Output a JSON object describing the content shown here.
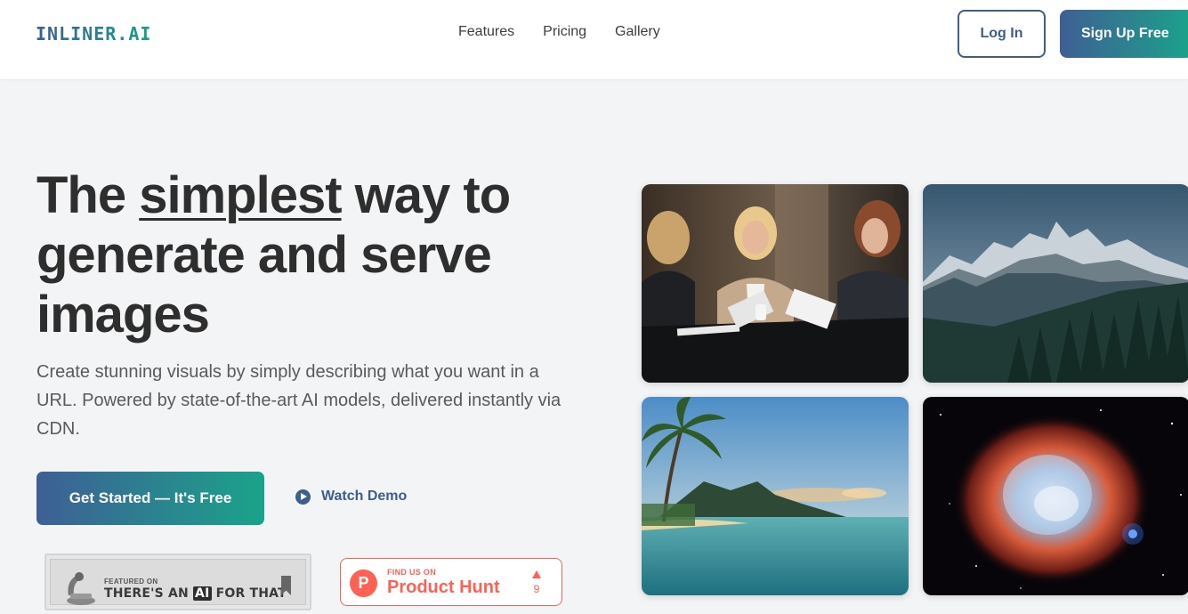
{
  "nav": {
    "logo": "INLINER.AI",
    "links": [
      "Features",
      "Pricing",
      "Gallery"
    ],
    "login_label": "Log In",
    "signup_label": "Sign Up Free"
  },
  "hero": {
    "title_part1": "The ",
    "title_emphasis": "simplest",
    "title_part2": " way to generate and serve images",
    "subtitle": "Create stunning visuals by simply describing what you want in a URL. Powered by state-of-the-art AI models, delivered instantly via CDN.",
    "cta_label": "Get Started — It's Free",
    "demo_label": "Watch Demo"
  },
  "badges": {
    "aift_small": "FEATURED ON",
    "aift_big_pre": "THERE'S AN ",
    "aift_big_ai": "AI",
    "aift_big_post": " FOR THAT",
    "ph_small": "FIND US ON",
    "ph_big": "Product Hunt",
    "ph_logo": "P",
    "ph_count": "9"
  },
  "gallery": [
    {
      "subject": "business-women-meeting"
    },
    {
      "subject": "snowy-mountain-range"
    },
    {
      "subject": "tropical-beach-sunset"
    },
    {
      "subject": "space-nebula"
    }
  ],
  "colors": {
    "brand_start": "#3e5f95",
    "brand_end": "#1aa38a",
    "product_hunt": "#ff6154"
  }
}
